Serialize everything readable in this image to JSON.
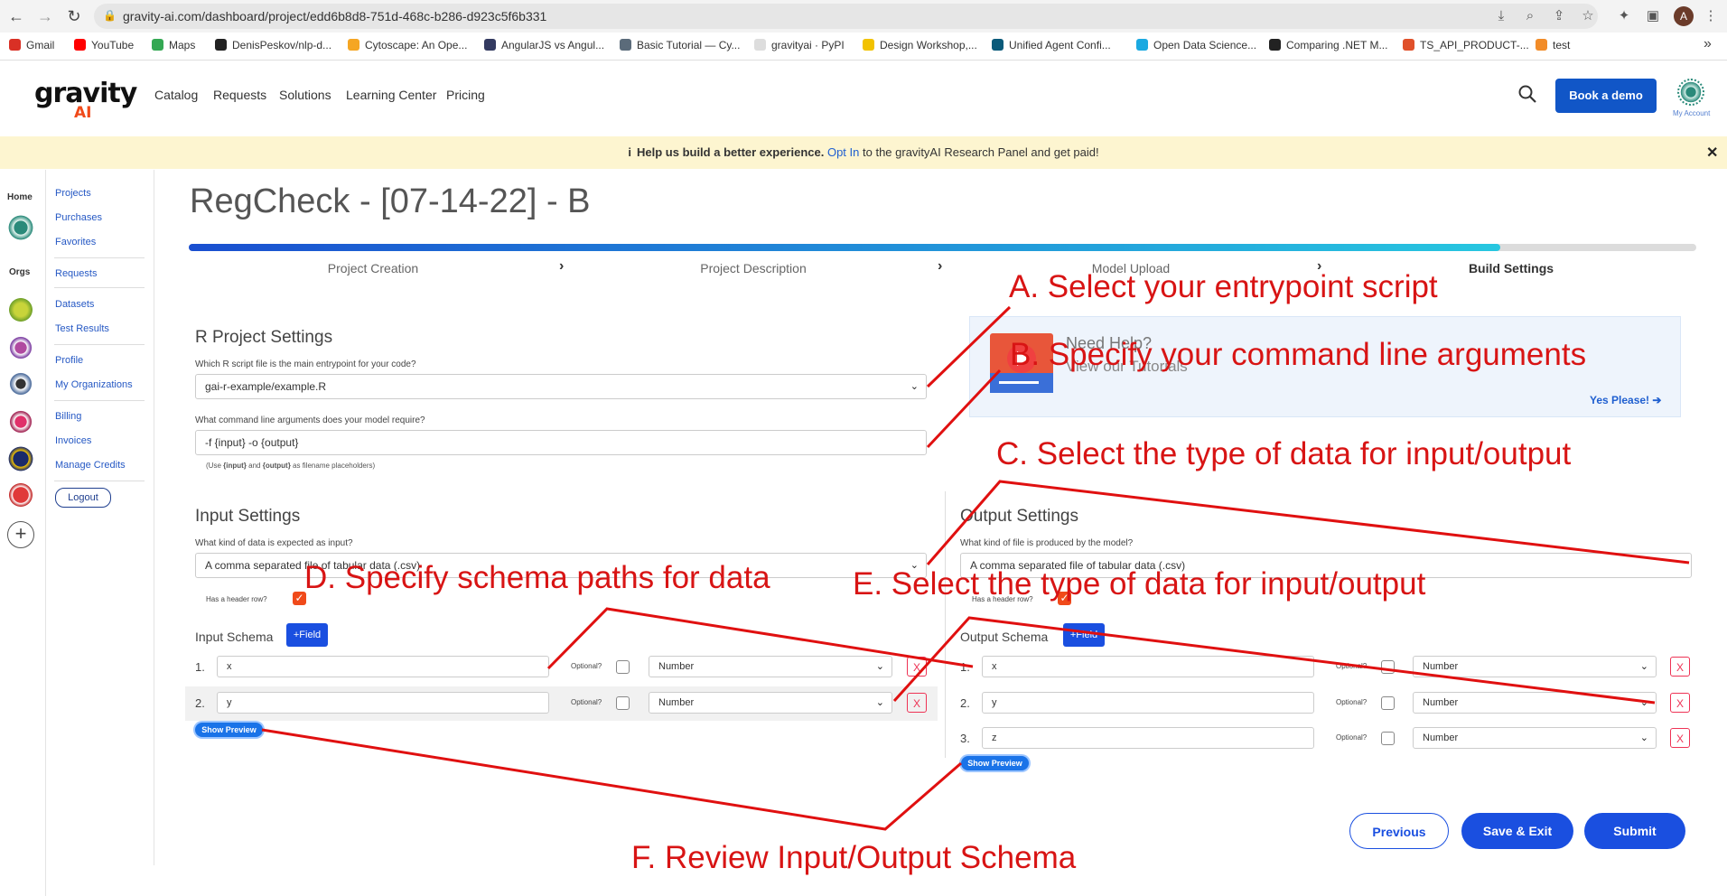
{
  "browser": {
    "url": "gravity-ai.com/dashboard/project/edd6b8d8-751d-468c-b286-d923c5f6b331",
    "profile_initial": "A",
    "bookmarks": [
      {
        "label": "Gmail",
        "color": "#d93025"
      },
      {
        "label": "YouTube",
        "color": "#ff0000"
      },
      {
        "label": "Maps",
        "color": "#34a853"
      },
      {
        "label": "DenisPeskov/nlp-d...",
        "color": "#222222"
      },
      {
        "label": "Cytoscape: An Ope...",
        "color": "#f5a623"
      },
      {
        "label": "AngularJS vs Angul...",
        "color": "#333a60"
      },
      {
        "label": "Basic Tutorial — Cy...",
        "color": "#5b6b7a"
      },
      {
        "label": "gravityai · PyPI",
        "color": "#dddddd"
      },
      {
        "label": "Design Workshop,...",
        "color": "#f2c200"
      },
      {
        "label": "Unified Agent Confi...",
        "color": "#0a5a7a"
      },
      {
        "label": "Open Data Science...",
        "color": "#1ba9e1"
      },
      {
        "label": "Comparing .NET M...",
        "color": "#222222"
      },
      {
        "label": "TS_API_PRODUCT-...",
        "color": "#e0502a"
      },
      {
        "label": "test",
        "color": "#f28c28"
      }
    ],
    "more": "»"
  },
  "header": {
    "logo_top": "gravity",
    "logo_bottom": "AI",
    "nav": [
      "Catalog",
      "Requests",
      "Solutions",
      "Learning Center",
      "Pricing"
    ],
    "book_demo": "Book a demo",
    "my_account": "My Account"
  },
  "banner": {
    "info_icon": "i",
    "bold": "Help us build a better experience.",
    "link": "Opt In",
    "rest": " to the gravityAI Research Panel and get paid!",
    "close": "✕"
  },
  "sidebar": {
    "home": "Home",
    "orgs": "Orgs",
    "add": "+",
    "links_group1": [
      "Projects",
      "Purchases",
      "Favorites"
    ],
    "links_group2": [
      "Requests"
    ],
    "links_group3": [
      "Datasets",
      "Test Results"
    ],
    "links_group4": [
      "Profile",
      "My Organizations"
    ],
    "links_group5": [
      "Billing",
      "Invoices",
      "Manage Credits"
    ],
    "logout": "Logout"
  },
  "main": {
    "title": "RegCheck - [07-14-22] - B",
    "progress": 0.87,
    "steps": [
      "Project Creation",
      "Project Description",
      "Model Upload",
      "Build Settings"
    ],
    "r_settings": {
      "heading": "R Project Settings",
      "entry_label": "Which R script file is the main entrypoint for your code?",
      "entry_value": "gai-r-example/example.R",
      "args_label": "What command line arguments does your model require?",
      "args_value": "-f  {input} -o {output}",
      "hint_pre": "(Use ",
      "hint_input": "{input}",
      "hint_mid": " and ",
      "hint_output": "{output}",
      "hint_post": " as filename placeholders)"
    },
    "help": {
      "title": "Need Help?",
      "sub": "View our Tutorials",
      "link": "Yes Please!"
    },
    "input": {
      "heading": "Input Settings",
      "kind_label": "What kind of data is expected as input?",
      "kind_value": "A comma separated file of tabular data (.csv)",
      "header_label": "Has a header row?",
      "schema_label": "Input Schema",
      "add_field": "+Field",
      "rows": [
        {
          "num": "1.",
          "name": "x",
          "type": "Number"
        },
        {
          "num": "2.",
          "name": "y",
          "type": "Number"
        }
      ],
      "preview": "Show Preview"
    },
    "output": {
      "heading": "Output Settings",
      "kind_label": "What kind of file is produced by the model?",
      "kind_value": "A comma separated file of tabular data (.csv)",
      "header_label": "Has a header row?",
      "schema_label": "Output Schema",
      "add_field": "+Field",
      "rows": [
        {
          "num": "1.",
          "name": "x",
          "type": "Number"
        },
        {
          "num": "2.",
          "name": "y",
          "type": "Number"
        },
        {
          "num": "3.",
          "name": "z",
          "type": "Number"
        }
      ],
      "preview": "Show Preview"
    },
    "optional_label": "Optional?",
    "remove": "X",
    "previous": "Previous",
    "save_exit": "Save & Exit",
    "submit": "Submit"
  },
  "annotations": {
    "a": "A. Select your entrypoint script",
    "b": "B. Specify your command line arguments",
    "c": "C. Select the type of data for input/output",
    "d": "D. Specify schema paths for data",
    "e": "E. Select the type of data for input/output",
    "f": "F. Review Input/Output Schema"
  }
}
